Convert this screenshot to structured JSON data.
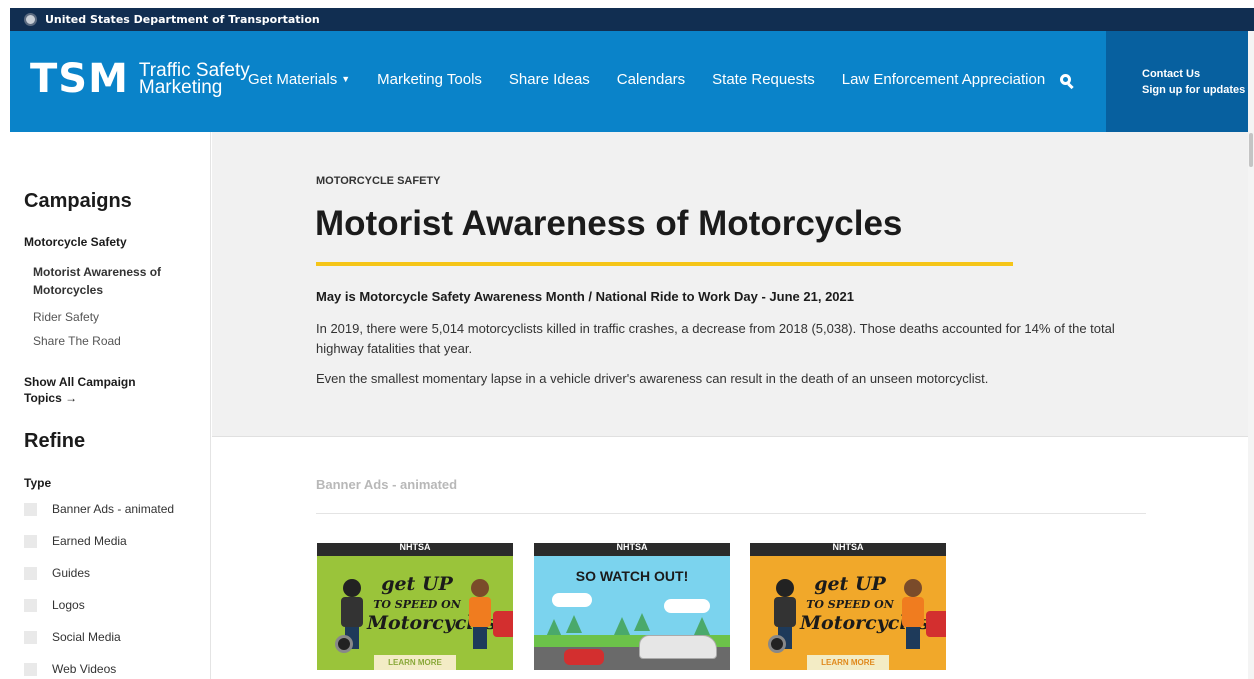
{
  "topbar": {
    "text": "United States Department of Transportation"
  },
  "logo": {
    "abbr": "TSM",
    "line1": "Traffic Safety",
    "line2": "Marketing"
  },
  "nav": {
    "items": [
      {
        "label": "Get Materials"
      },
      {
        "label": "Marketing Tools"
      },
      {
        "label": "Share Ideas"
      },
      {
        "label": "Calendars"
      },
      {
        "label": "State Requests"
      },
      {
        "label": "Law Enforcement Appreciation"
      }
    ],
    "contact": "Contact Us",
    "signup": "Sign up for updates"
  },
  "sidebar": {
    "campaigns_heading": "Campaigns",
    "category": "Motorcycle Safety",
    "links": [
      {
        "label": "Motorist Awareness of Motorcycles"
      },
      {
        "label": "Rider Safety"
      },
      {
        "label": "Share The Road"
      }
    ],
    "show_all": "Show All Campaign Topics →",
    "refine_heading": "Refine",
    "type_label": "Type",
    "filters": [
      {
        "label": "Banner Ads - animated"
      },
      {
        "label": "Earned Media"
      },
      {
        "label": "Guides"
      },
      {
        "label": "Logos"
      },
      {
        "label": "Social Media"
      },
      {
        "label": "Web Videos"
      }
    ]
  },
  "intro": {
    "eyebrow": "MOTORCYCLE SAFETY",
    "title": "Motorist Awareness of Motorcycles",
    "headline": "May is Motorcycle Safety Awareness Month / National Ride to Work Day - June 21, 2021",
    "paragraph1": "In 2019, there were 5,014 motorcyclists killed in traffic crashes, a decrease from 2018 (5,038). Those deaths accounted for 14% of the total highway fatalities that year.",
    "paragraph2": "Even the smallest momentary lapse in a vehicle driver's awareness can result in the death of an unseen motorcyclist."
  },
  "materials": {
    "section_label": "Banner Ads - animated",
    "ads": [
      {
        "top": "NHTSA",
        "line1": "get UP",
        "line2": "TO SPEED ON",
        "line3": "Motorcycles",
        "cta": "LEARN MORE"
      },
      {
        "top": "NHTSA",
        "headline": "SO WATCH OUT!"
      },
      {
        "top": "NHTSA",
        "line1": "get UP",
        "line2": "TO SPEED ON",
        "line3": "Motorcycles",
        "cta": "LEARN MORE"
      }
    ]
  }
}
